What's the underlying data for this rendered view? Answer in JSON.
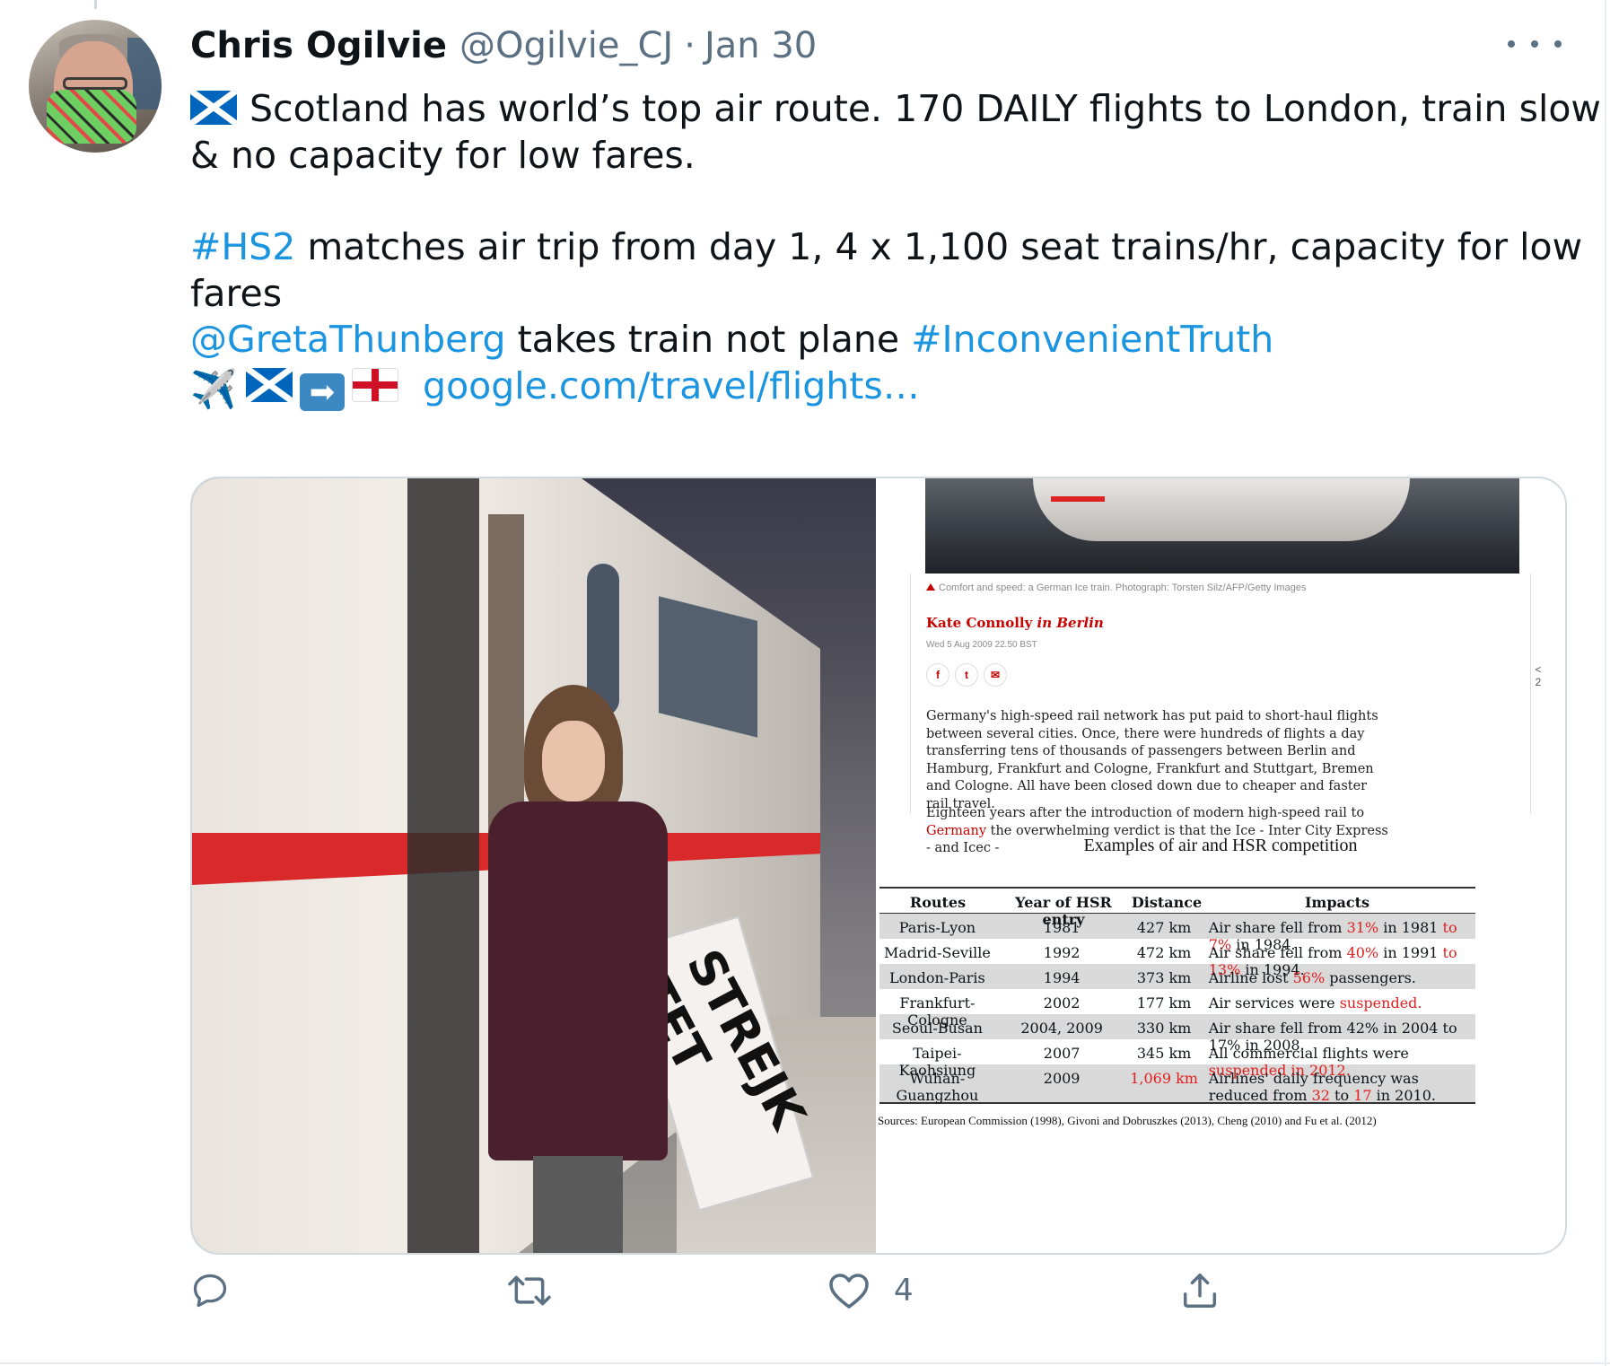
{
  "tweet": {
    "name": "Chris Ogilvie",
    "handle": "@Ogilvie_CJ",
    "separator": "·",
    "date": "Jan 30",
    "line1": "Scotland has world’s top air route. 170 DAILY flights to London, train slow",
    "line2": "& no capacity for low fares.",
    "hashtag_hs2": "#HS2",
    "line3_rest": " matches air trip from day 1, 4 x 1,100 seat trains/hr, capacity for low",
    "line4": "fares",
    "mention": "@GretaThunberg",
    "line5_mid": " takes train not plane ",
    "hashtag_truth": "#InconvenientTruth",
    "link": "google.com/travel/flights…",
    "emoji_plane": "✈️",
    "emoji_arrow": "➡"
  },
  "article": {
    "caption": "Comfort and speed: a German Ice train. Photograph: Torsten Silz/AFP/Getty Images",
    "author": "Kate Connolly",
    "author_loc": " in Berlin",
    "published": "Wed 5 Aug 2009 22.50 BST",
    "share_icons": [
      "f",
      "t",
      "✉"
    ],
    "side_text": "<\n2",
    "para1": "Germany's high-speed rail network has put paid to short-haul flights between several cities. Once, there were hundreds of flights a day transferring tens of thousands of passengers between Berlin and Hamburg, Frankfurt and Cologne, Frankfurt and Stuttgart, Bremen and Cologne. All have been closed down due to cheaper and faster rail travel.",
    "para2_start": "Eighteen years after the introduction of modern high-speed rail to ",
    "para2_link": "Germany",
    "para2_end": " the overwhelming verdict is that the Ice - Inter City Express - and Icec -"
  },
  "table": {
    "title": "Examples of air and HSR competition",
    "headers": [
      "Routes",
      "Year of HSR entry",
      "Distance",
      "Impacts"
    ],
    "rows": [
      {
        "route": "Paris-Lyon",
        "year": "1981",
        "distance": "427 km",
        "impact": "Air share fell from <r>31%</r> in 1981 <r>to 7%</r> in 1984."
      },
      {
        "route": "Madrid-Seville",
        "year": "1992",
        "distance": "472 km",
        "impact": "Air share fell from <r>40%</r> in 1991 <r>to 13%</r> in 1994."
      },
      {
        "route": "London-Paris",
        "year": "1994",
        "distance": "373 km",
        "impact": "Airline lost <r>56%</r> passengers."
      },
      {
        "route": "Frankfurt-Cologne",
        "year": "2002",
        "distance": "177 km",
        "impact": "Air services were <r>suspended.</r>"
      },
      {
        "route": "Seoul-Busan",
        "year": "2004, 2009",
        "distance": "330 km",
        "impact": "Air share fell from 42% in 2004 to 17% in 2008."
      },
      {
        "route": "Taipei-Kaohsiung",
        "year": "2007",
        "distance": "345 km",
        "impact": "All commercial flights were <r>suspended in 2012.</r>"
      },
      {
        "route": "Wuhan-Guangzhou",
        "year": "2009",
        "distance": "<r>1,069 km</r>",
        "impact": "Airlines' daily frequency was reduced from <r>32</r> to <r>17</r> in 2010."
      }
    ],
    "sources": "Sources:  European Commission (1998), Givoni and Dobruszkes (2013), Cheng (2010) and Fu et al. (2012)"
  },
  "photo": {
    "sign_text": "STREJK\nTET"
  },
  "actions": {
    "reply_icon": "reply-icon",
    "retweet_icon": "retweet-icon",
    "like_icon": "heart-icon",
    "like_count": "4",
    "share_icon": "share-icon"
  },
  "colors": {
    "link": "#1b95e0",
    "secondary": "#5b7083",
    "article_red": "#c70000",
    "table_red": "#e02020"
  }
}
